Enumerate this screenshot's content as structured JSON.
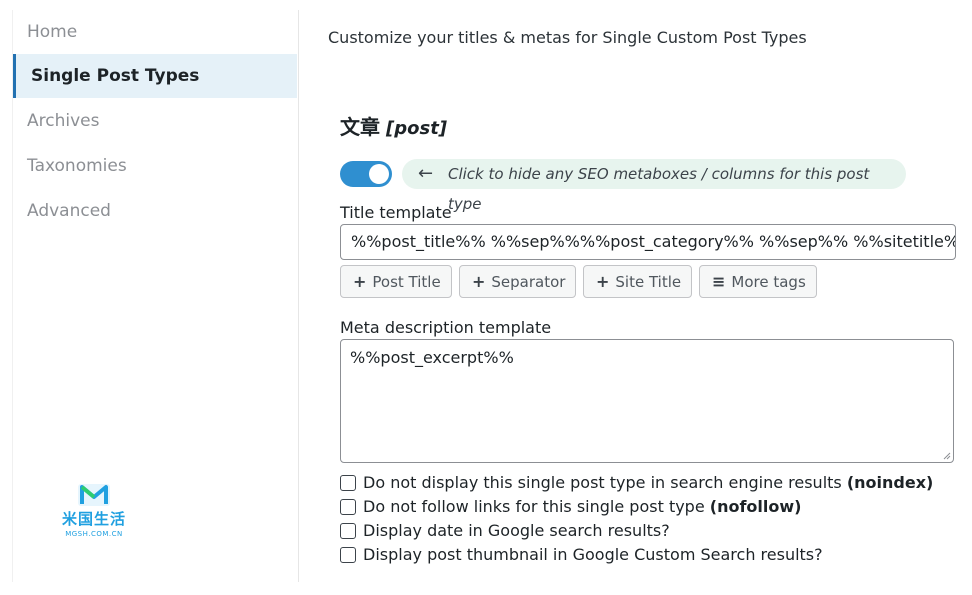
{
  "sidebar": {
    "items": [
      {
        "label": "Home",
        "active": false
      },
      {
        "label": "Single Post Types",
        "active": true
      },
      {
        "label": "Archives",
        "active": false
      },
      {
        "label": "Taxonomies",
        "active": false
      },
      {
        "label": "Advanced",
        "active": false
      }
    ],
    "logo": {
      "name": "米国生活",
      "domain": "MGSH.COM.CN"
    }
  },
  "main": {
    "subtitle": "Customize your titles & metas for Single Custom Post Types",
    "post_type": {
      "name": "文章",
      "slug": "[post]"
    },
    "toggle": {
      "on": true,
      "hint": "Click to hide any SEO metaboxes / columns for this post type"
    },
    "title_template": {
      "label": "Title template",
      "value": "%%post_title%% %%sep%%%%post_category%% %%sep%%  %%sitetitle%%"
    },
    "tag_buttons": [
      "Post Title",
      "Separator",
      "Site Title",
      "More tags"
    ],
    "meta_description": {
      "label": "Meta description template",
      "value": "%%post_excerpt%%"
    },
    "checkboxes": [
      {
        "text": "Do not display this single post type in search engine results ",
        "bold": "(noindex)",
        "checked": false
      },
      {
        "text": "Do not follow links for this single post type ",
        "bold": "(nofollow)",
        "checked": false
      },
      {
        "text": "Display date in Google search results?",
        "bold": "",
        "checked": false
      },
      {
        "text": "Display post thumbnail in Google Custom Search results?",
        "bold": "",
        "checked": false
      }
    ]
  },
  "colors": {
    "accent": "#2f8fd0",
    "active_nav_bg": "#e5f1f8",
    "hint_bg": "#e7f4ee",
    "logo": "#20a0e0"
  }
}
